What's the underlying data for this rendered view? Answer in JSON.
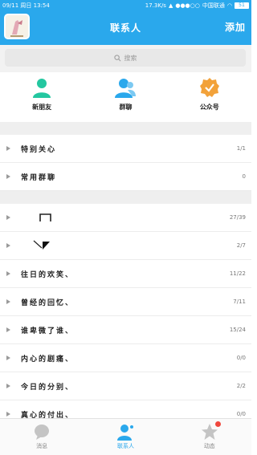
{
  "status_bar": {
    "datetime": "09/11 周日 13:54",
    "speed": "17.3K/s",
    "carrier": "中国联通",
    "battery": "51"
  },
  "header": {
    "title": "联系人",
    "add_label": "添加"
  },
  "search": {
    "placeholder": "搜索"
  },
  "shortcuts": [
    {
      "label": "新朋友",
      "icon": "person-icon",
      "color": "#24c7a0"
    },
    {
      "label": "群聊",
      "icon": "group-icon",
      "color": "#2aa8ec"
    },
    {
      "label": "公众号",
      "icon": "badge-check-icon",
      "color": "#f2a23a"
    }
  ],
  "groups": [
    {
      "name": "特别关心",
      "count": "1/1"
    },
    {
      "name": "常用群聊",
      "count": "0"
    },
    {
      "name": "",
      "count": "27/39"
    },
    {
      "name": "",
      "count": "2/7"
    },
    {
      "name": "往日的欢笑、",
      "count": "11/22"
    },
    {
      "name": "曾经的回忆、",
      "count": "7/11"
    },
    {
      "name": "谁卑微了谁、",
      "count": "15/24"
    },
    {
      "name": "内心的剧痛、",
      "count": "0/0"
    },
    {
      "name": "今日的分别、",
      "count": "2/2"
    },
    {
      "name": "真心的付出、",
      "count": "0/0"
    }
  ],
  "tabs": [
    {
      "label": "消息",
      "icon": "chat-bubble-icon"
    },
    {
      "label": "联系人",
      "icon": "contacts-icon"
    },
    {
      "label": "动态",
      "icon": "star-icon"
    }
  ],
  "colors": {
    "accent": "#2aa8ec",
    "new_friend": "#24c7a0",
    "public_account": "#f2a23a",
    "notification": "#f0483e"
  }
}
